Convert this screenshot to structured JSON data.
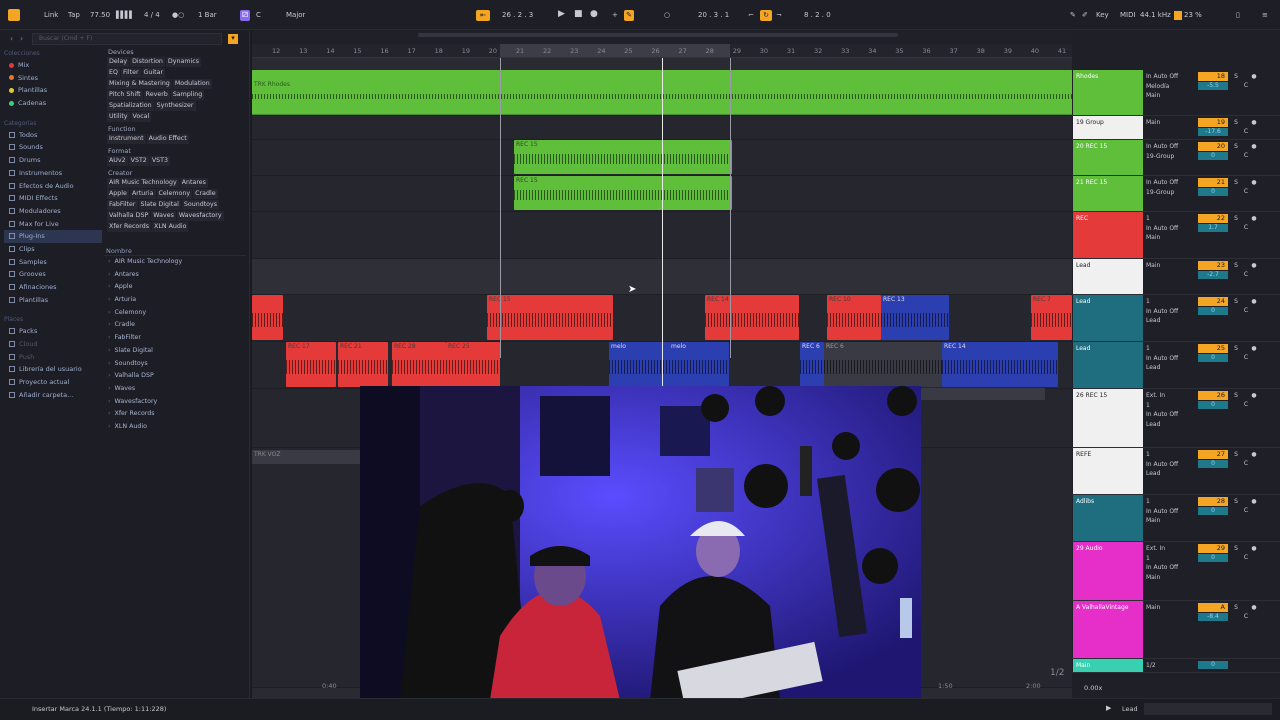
{
  "topbar": {
    "link": "Link",
    "tap": "Tap",
    "tempo": "77.50",
    "time_sig": "4 / 4",
    "quantize": "1 Bar",
    "key": "C",
    "scale": "Major",
    "position": "26 . 2 . 3",
    "loop_start": "20 . 3 . 1",
    "loop_length": "8 . 2 . 0",
    "key_label": "Key",
    "midi_label": "MIDI",
    "sample_rate": "44.1 kHz",
    "cpu": "23 %"
  },
  "browser": {
    "search_placeholder": "Buscar (Cmd + F)",
    "collections_title": "Colecciones",
    "collections": [
      {
        "label": "Mix",
        "color": "#e03a3a"
      },
      {
        "label": "Sintes",
        "color": "#e07a2a"
      },
      {
        "label": "Plantillas",
        "color": "#e0c83a"
      },
      {
        "label": "Cadenas",
        "color": "#3ad07a"
      }
    ],
    "categories_title": "Categorías",
    "categories": [
      "Todos",
      "Sounds",
      "Drums",
      "Instrumentos",
      "Efectos de Audio",
      "MIDI Effects",
      "Moduladores",
      "Max for Live",
      "Plug-Ins",
      "Clips",
      "Samples",
      "Grooves",
      "Afinaciones",
      "Plantillas"
    ],
    "places_title": "Places",
    "places": [
      "Packs",
      "Cloud",
      "Push",
      "Librería del usuario",
      "Proyecto actual",
      "Añadir carpeta..."
    ],
    "filters": {
      "devices_title": "Devices",
      "devices": [
        [
          "Delay",
          "Distortion",
          "Dynamics"
        ],
        [
          "EQ",
          "Filter",
          "Guitar"
        ],
        [
          "Mixing & Mastering",
          "Modulation"
        ],
        [
          "Pitch Shift",
          "Reverb",
          "Sampling"
        ],
        [
          "Spatialization",
          "Synthesizer"
        ],
        [
          "Utility",
          "Vocal"
        ]
      ],
      "function_title": "Function",
      "function": [
        [
          "Instrument",
          "Audio Effect"
        ]
      ],
      "format_title": "Format",
      "format": [
        [
          "AUv2",
          "VST2",
          "VST3"
        ]
      ],
      "creator_title": "Creator",
      "creator": [
        [
          "AIR Music Technology",
          "Antares"
        ],
        [
          "Apple",
          "Arturia",
          "Celemony",
          "Cradle"
        ],
        [
          "FabFilter",
          "Slate Digital",
          "Soundtoys"
        ],
        [
          "Valhalla DSP",
          "Waves",
          "Wavesfactory"
        ],
        [
          "Xfer Records",
          "XLN Audio"
        ]
      ]
    },
    "name_header": "Nombre",
    "names": [
      "AIR Music Technology",
      "Antares",
      "Apple",
      "Arturia",
      "Celemony",
      "Cradle",
      "FabFilter",
      "Slate Digital",
      "Soundtoys",
      "Valhalla DSP",
      "Waves",
      "Wavesfactory",
      "Xfer Records",
      "XLN Audio"
    ]
  },
  "arrangement": {
    "bars": [
      "12",
      "13",
      "14",
      "15",
      "16",
      "17",
      "18",
      "19",
      "20",
      "21",
      "22",
      "23",
      "24",
      "25",
      "26",
      "27",
      "28",
      "29",
      "30",
      "31",
      "32",
      "33",
      "34",
      "35",
      "36",
      "37",
      "38",
      "39",
      "40",
      "41"
    ],
    "clips": {
      "rhodes": "TRK Rhodes",
      "rec15": "REC 15",
      "rec13": "REC 13",
      "rec14": "REC 14",
      "rec10": "REC 10",
      "rec7": "REC 7",
      "rec17": "REC 17",
      "rec21": "REC 21",
      "rec28": "REC 28",
      "rec25": "REC 25",
      "rec6": "REC 6",
      "melo": "melo",
      "trk_voz": "TRK VOZ"
    },
    "time_left": "0:40",
    "time_mid": "1:50",
    "time_right": "2:00",
    "page": "1/2"
  },
  "tracks": [
    {
      "name": "Rhodes",
      "color": "#5fbf3a",
      "io": [
        "In  Auto  Off",
        "Melodía",
        "Main"
      ],
      "num": "18",
      "vol": "-5.5",
      "h": 46
    },
    {
      "name": "19 Group",
      "color": "#f0f0f0",
      "io": [
        "Main"
      ],
      "num": "19",
      "vol": "-17.6",
      "h": 24
    },
    {
      "name": "20 REC 15",
      "color": "#5fbf3a",
      "io": [
        "In  Auto  Off",
        "19-Group"
      ],
      "num": "20",
      "vol": "0",
      "h": 36
    },
    {
      "name": "21 REC 15",
      "color": "#5fbf3a",
      "io": [
        "In  Auto  Off",
        "19-Group"
      ],
      "num": "21",
      "vol": "0",
      "h": 36
    },
    {
      "name": "REC",
      "color": "#e53a3a",
      "io": [
        "1",
        "In  Auto  Off",
        "Main"
      ],
      "num": "22",
      "vol": "1.7",
      "h": 47
    },
    {
      "name": "Lead",
      "color": "#f0f0f0",
      "io": [
        "Main"
      ],
      "num": "23",
      "vol": "-2.7",
      "h": 36
    },
    {
      "name": "Lead",
      "color": "#1e6e80",
      "io": [
        "1",
        "In  Auto  Off",
        "Lead"
      ],
      "num": "24",
      "vol": "0",
      "h": 47
    },
    {
      "name": "Lead",
      "color": "#1e6e80",
      "io": [
        "1",
        "In  Auto  Off",
        "Lead"
      ],
      "num": "25",
      "vol": "0",
      "h": 47
    },
    {
      "name": "26 REC 15",
      "color": "#f0f0f0",
      "io": [
        "Ext. In",
        "1",
        "In  Auto  Off",
        "Lead"
      ],
      "num": "26",
      "vol": "0",
      "h": 59
    },
    {
      "name": "REFE",
      "color": "#f0f0f0",
      "io": [
        "1",
        "In  Auto  Off",
        "Lead"
      ],
      "num": "27",
      "vol": "0",
      "h": 47
    },
    {
      "name": "Adlibs",
      "color": "#1e6e80",
      "io": [
        "1",
        "In  Auto  Off",
        "Main"
      ],
      "num": "28",
      "vol": "0",
      "h": 47
    },
    {
      "name": "29 Audio",
      "color": "#e62fc8",
      "io": [
        "Ext. In",
        "1",
        "In  Auto  Off",
        "Main"
      ],
      "num": "29",
      "vol": "0",
      "h": 59
    },
    {
      "name": "A ValhallaVintage",
      "color": "#e62fc8",
      "io": [
        "Main"
      ],
      "num": "A",
      "vol": "-8.4",
      "h": 58
    },
    {
      "name": "Main",
      "color": "#38d0b0",
      "io": [
        "1/2"
      ],
      "num": "",
      "vol": "0",
      "h": 14
    }
  ],
  "status": {
    "message": "Insertar Marca 24.1.1 (Tiempo: 1:11:228)",
    "zoom": "0.00x",
    "track_sel": "Lead"
  }
}
